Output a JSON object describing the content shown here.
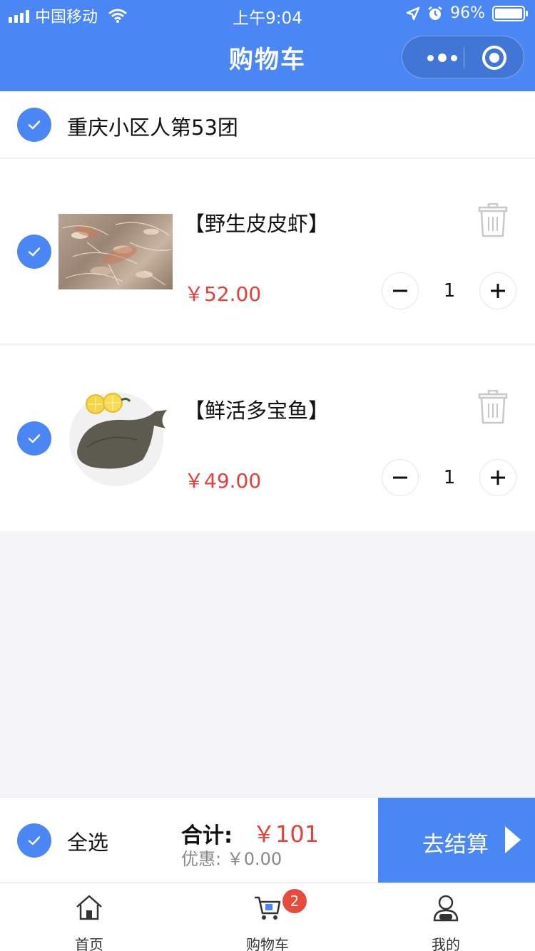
{
  "status_bar": {
    "carrier": "中国移动",
    "time": "上午9:04",
    "battery": "96%"
  },
  "header": {
    "title": "购物车"
  },
  "group": {
    "name": "重庆小区人第53团"
  },
  "items": [
    {
      "name": "【野生皮皮虾】",
      "price": "￥52.00",
      "qty": "1",
      "image": "shrimp"
    },
    {
      "name": "【鲜活多宝鱼】",
      "price": "￥49.00",
      "qty": "1",
      "image": "turbot-fish"
    }
  ],
  "checkout": {
    "select_all": "全选",
    "total_label": "合计:",
    "total_value": "￥101",
    "discount": "优惠: ￥0.00",
    "button": "去结算"
  },
  "tabs": [
    {
      "label": "首页",
      "icon": "home-icon"
    },
    {
      "label": "购物车",
      "icon": "cart-icon",
      "badge": "2"
    },
    {
      "label": "我的",
      "icon": "user-icon"
    }
  ],
  "colors": {
    "accent": "#4a86f4",
    "price": "#e3403a",
    "badge": "#e84a3c",
    "page_bg": "#f5f5f7"
  }
}
